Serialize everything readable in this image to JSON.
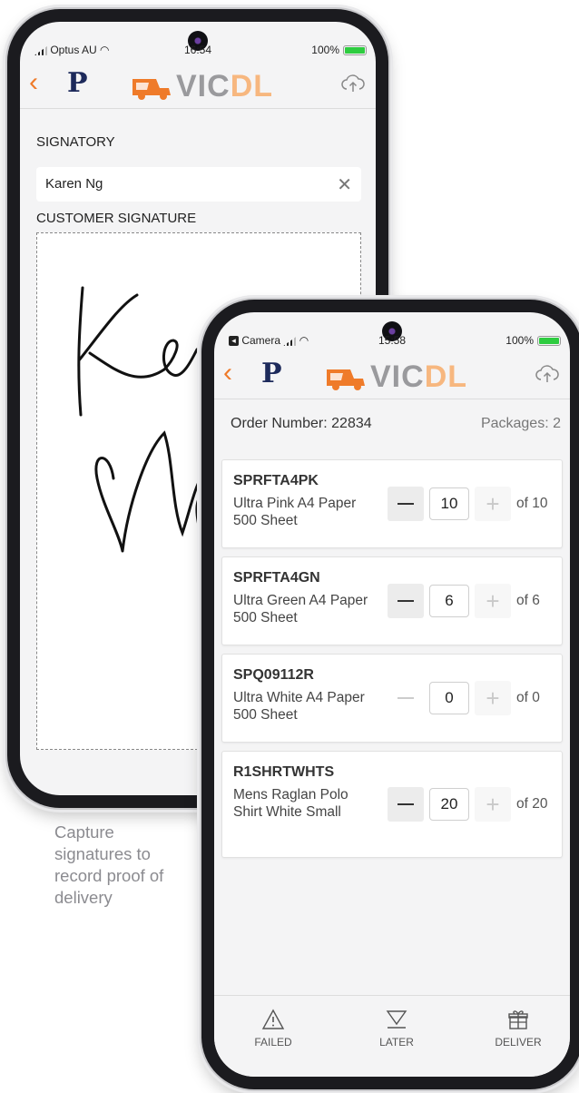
{
  "back_phone": {
    "status": {
      "carrier": "Optus AU",
      "time": "16:54",
      "battery": "100%"
    },
    "signatory_label": "SIGNATORY",
    "signatory_value": "Karen Ng",
    "customer_signature_label": "CUSTOMER SIGNATURE"
  },
  "brand": {
    "vic": "VIC",
    "dl": "DL",
    "p_logo": "P"
  },
  "caption": "Capture signatures to record proof of delivery",
  "front_phone": {
    "status": {
      "carrier": "Camera",
      "time": "15:58",
      "battery": "100%"
    },
    "order_number_label": "Order Number: 22834",
    "packages_label": "Packages: 2",
    "items": [
      {
        "sku": "SPRFTA4PK",
        "desc": "Ultra Pink A4 Paper 500 Sheet",
        "qty": "10",
        "of": "of 10",
        "minus_enabled": true
      },
      {
        "sku": "SPRFTA4GN",
        "desc": "Ultra Green A4 Paper 500 Sheet",
        "qty": "6",
        "of": "of 6",
        "minus_enabled": true
      },
      {
        "sku": "SPQ09112R",
        "desc": "Ultra White A4 Paper 500 Sheet",
        "qty": "0",
        "of": "of 0",
        "minus_enabled": false
      },
      {
        "sku": "R1SHRTWHTS",
        "desc": "Mens Raglan Polo Shirt White Small",
        "qty": "20",
        "of": "of 20",
        "minus_enabled": true
      }
    ],
    "tabs": {
      "failed": "FAILED",
      "later": "LATER",
      "deliver": "DELIVER"
    }
  },
  "colors": {
    "accent": "#ef7b2a",
    "dl": "#f7b77f",
    "vic": "#9a9a9d",
    "p_logo": "#1d2a5b"
  }
}
